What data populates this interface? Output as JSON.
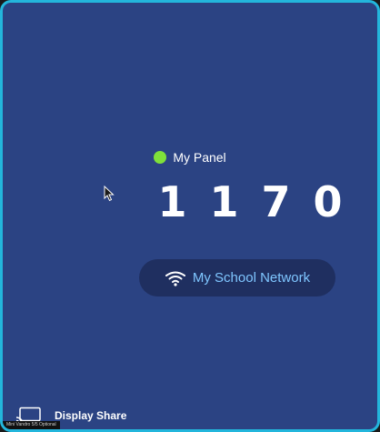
{
  "panel": {
    "name": "My Panel",
    "status_color": "#7fe03a",
    "status_icon": "status-dot-icon"
  },
  "connection_code": {
    "digits": [
      "1",
      "1",
      "7",
      "0"
    ]
  },
  "network": {
    "name": "My School Network",
    "icon": "wifi-icon"
  },
  "footer": {
    "icon": "cast-icon",
    "label": "Display Share",
    "device_caption": "Mini Vandro 5/5 Optional"
  },
  "colors": {
    "background": "#2b4383",
    "border": "#23b6dc",
    "network_pill": "#1f2f60",
    "network_text": "#7fc6ff"
  }
}
